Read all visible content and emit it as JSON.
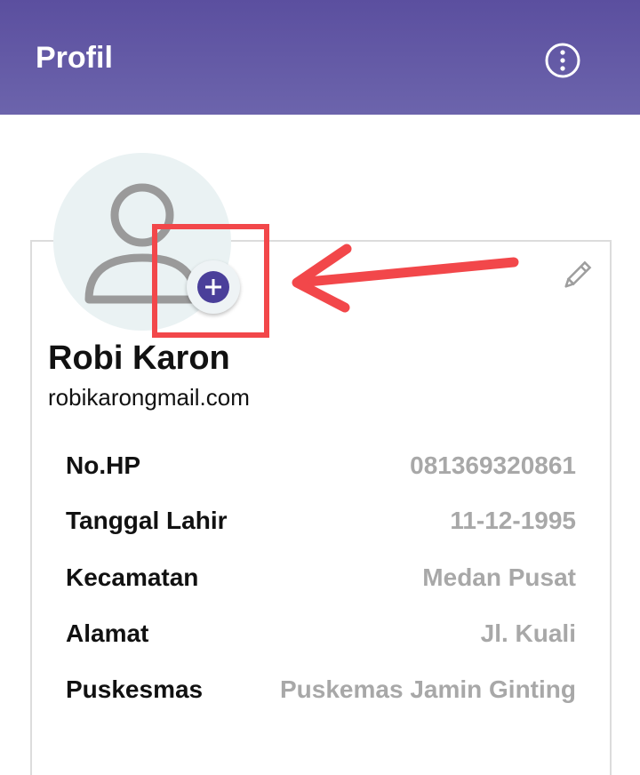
{
  "appbar": {
    "title": "Profil",
    "menu_icon": "more-vertical-circle-icon"
  },
  "profile": {
    "name": "Robi Karon",
    "email": "robikarongmail.com",
    "avatar_icon": "person-placeholder-icon",
    "add_photo_icon": "plus-circle-icon",
    "edit_icon": "pencil-icon"
  },
  "details": [
    {
      "label": "No.HP",
      "value": "081369320861"
    },
    {
      "label": "Tanggal Lahir",
      "value": "11-12-1995"
    },
    {
      "label": "Kecamatan",
      "value": "Medan Pusat"
    },
    {
      "label": "Alamat",
      "value": "Jl. Kuali"
    },
    {
      "label": "Puskesmas",
      "value": "Puskemas Jamin Ginting"
    }
  ],
  "colors": {
    "appbar": "#5b4f9f",
    "accent": "#4a3f9a",
    "annotation": "#f2474a",
    "value_text": "#a8a8a8"
  }
}
